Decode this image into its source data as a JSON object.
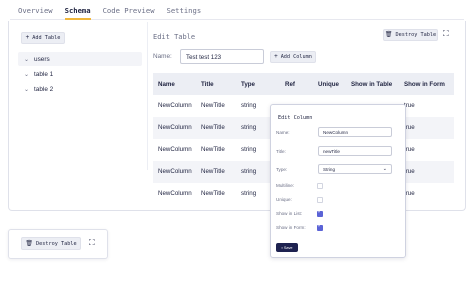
{
  "tabs": [
    {
      "label": "Overview",
      "active": false
    },
    {
      "label": "Schema",
      "active": true
    },
    {
      "label": "Code Preview",
      "active": false
    },
    {
      "label": "Settings",
      "active": false
    }
  ],
  "toolbar": {
    "add_table_label": "Add Table",
    "destroy_table_label": "Destroy Table"
  },
  "tree": {
    "items": [
      {
        "label": "users",
        "selected": true
      },
      {
        "label": "table 1",
        "selected": false
      },
      {
        "label": "table 2",
        "selected": false
      }
    ]
  },
  "editor": {
    "title": "Edit Table",
    "name_label": "Name:",
    "name_value": "Test test 123",
    "add_column_label": "Add Column"
  },
  "table": {
    "headers": [
      "Name",
      "Title",
      "Type",
      "Ref",
      "Unique",
      "Show in Table",
      "Show in Form"
    ],
    "rows": [
      {
        "name": "NewColumn",
        "title": "NewTitle",
        "type": "string",
        "ref": "false",
        "unique": "false",
        "show_table": "true",
        "show_form": "true"
      },
      {
        "name": "NewColumn",
        "title": "NewTitle",
        "type": "string",
        "ref": "false",
        "unique": "false",
        "show_table": "true",
        "show_form": "true"
      },
      {
        "name": "NewColumn",
        "title": "NewTitle",
        "type": "string",
        "ref": "false",
        "unique": "false",
        "show_table": "true",
        "show_form": "true"
      },
      {
        "name": "NewColumn",
        "title": "NewTitle",
        "type": "string",
        "ref": "false",
        "unique": "false",
        "show_table": "true",
        "show_form": "true"
      },
      {
        "name": "NewColumn",
        "title": "NewTitle",
        "type": "string",
        "ref": "false",
        "unique": "false",
        "show_table": "true",
        "show_form": "true"
      }
    ]
  },
  "edit_column": {
    "title": "Edit Column",
    "name_label": "Name:",
    "name_value": "NewColumn",
    "title_label": "Title:",
    "title_value": "newTitle",
    "type_label": "Type:",
    "type_value": "String",
    "multiline_label": "Multiline:",
    "multiline": false,
    "unique_label": "Unique:",
    "unique": false,
    "show_in_list_label": "Show in List:",
    "show_in_list": true,
    "show_in_form_label": "Show in Form:",
    "show_in_form": true,
    "save_label": "Save"
  },
  "secondary": {
    "destroy_table_label": "Destroy Table"
  },
  "icons": {
    "add": "plus-icon",
    "trash": "trash-icon",
    "expand": "expand-icon",
    "chevron": "chevron-down-icon"
  },
  "colors": {
    "accent_tab": "#f0b63a",
    "checkbox_on": "#5b63d6",
    "save_button": "#1e2250",
    "text": "#1f2340"
  }
}
